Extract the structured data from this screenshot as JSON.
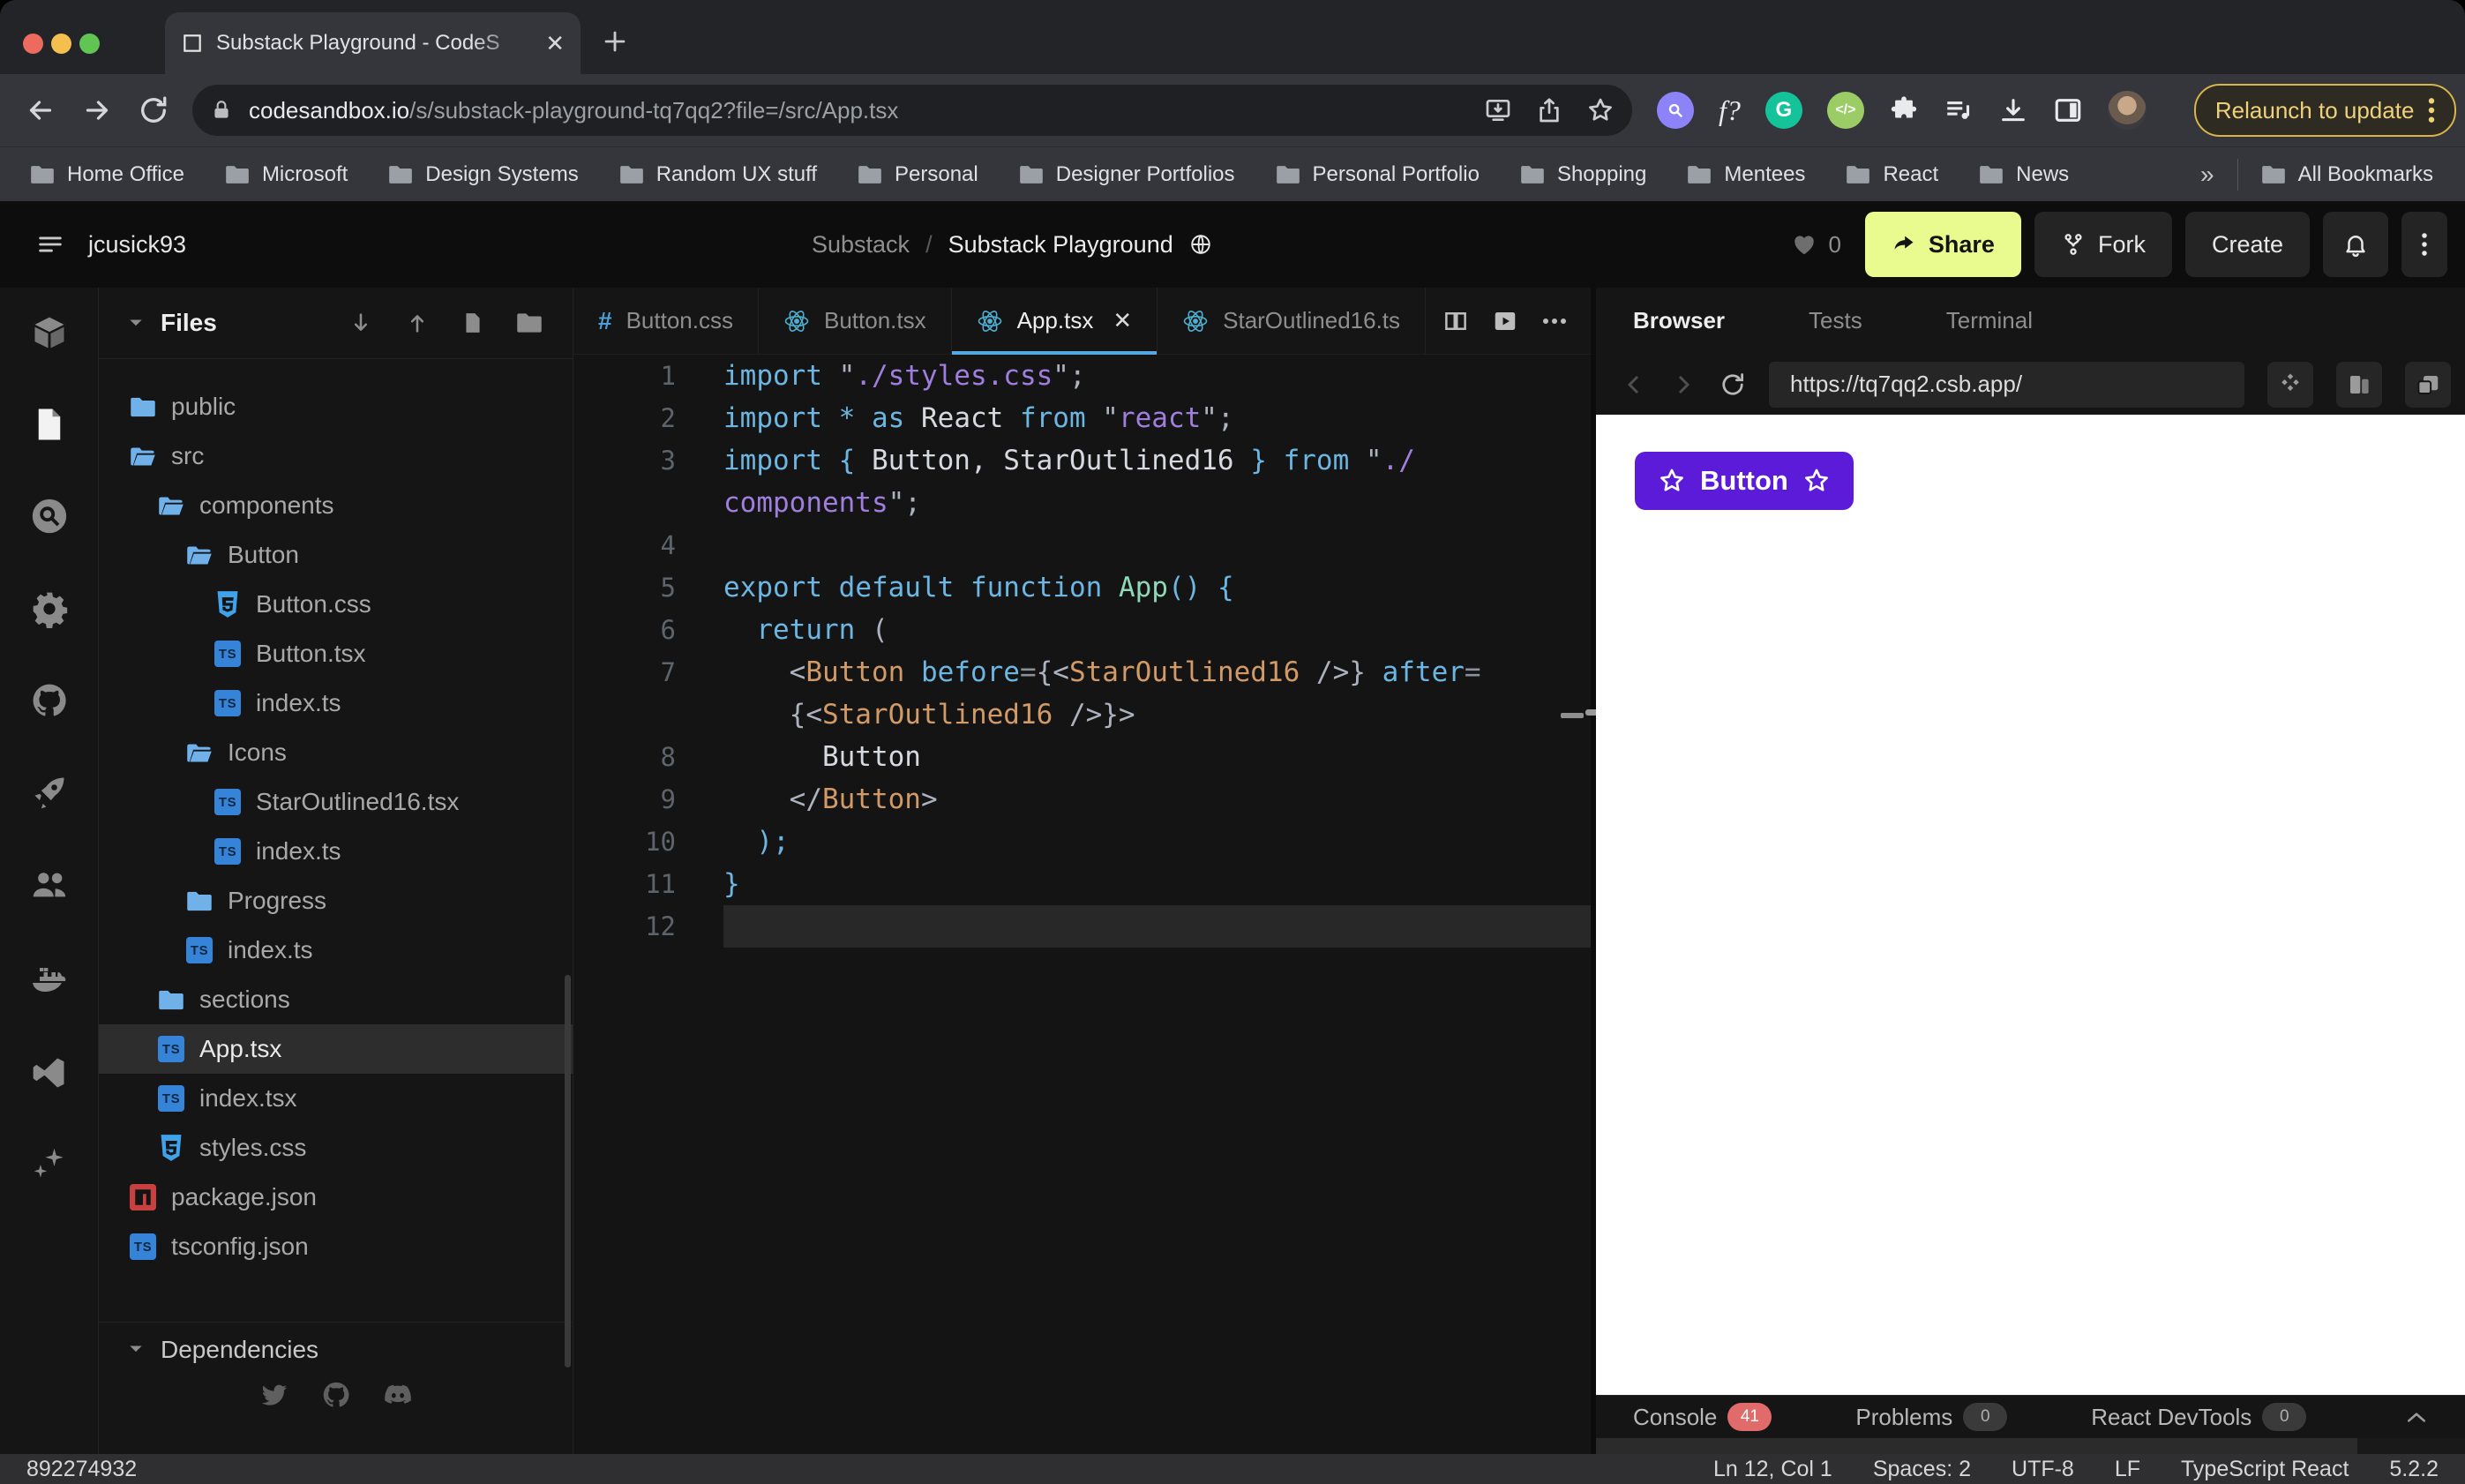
{
  "browser": {
    "tab_title": "Substack Playground - CodeS",
    "url_host": "codesandbox.io",
    "url_path": "/s/substack-playground-tq7qq2?file=/src/App.tsx",
    "relaunch_label": "Relaunch to update",
    "bookmarks": [
      "Home Office",
      "Microsoft",
      "Design Systems",
      "Random UX stuff",
      "Personal",
      "Designer Portfolios",
      "Personal Portfolio",
      "Shopping",
      "Mentees",
      "React",
      "News"
    ],
    "overflow_chevron": "»",
    "all_bookmarks_label": "All Bookmarks",
    "extension_letters": {
      "grammarly": "G",
      "font_finder": "f?"
    }
  },
  "header": {
    "username": "jcusick93",
    "breadcrumb_parent": "Substack",
    "breadcrumb_separator": "/",
    "breadcrumb_current": "Substack Playground",
    "likes_count": "0",
    "share_label": "Share",
    "fork_label": "Fork",
    "create_label": "Create",
    "share_color": "#E9FB8E"
  },
  "sidebar": {
    "title": "Files",
    "tree": [
      {
        "label": "public",
        "icon": "folder-closed",
        "level": 0
      },
      {
        "label": "src",
        "icon": "folder-open",
        "level": 0
      },
      {
        "label": "components",
        "icon": "folder-open",
        "level": 1
      },
      {
        "label": "Button",
        "icon": "folder-open",
        "level": 2
      },
      {
        "label": "Button.css",
        "icon": "css",
        "level": 3
      },
      {
        "label": "Button.tsx",
        "icon": "ts",
        "level": 3
      },
      {
        "label": "index.ts",
        "icon": "ts",
        "level": 3
      },
      {
        "label": "Icons",
        "icon": "folder-open",
        "level": 2
      },
      {
        "label": "StarOutlined16.tsx",
        "icon": "ts",
        "level": 3
      },
      {
        "label": "index.ts",
        "icon": "ts",
        "level": 3
      },
      {
        "label": "Progress",
        "icon": "folder-closed",
        "level": 2
      },
      {
        "label": "index.ts",
        "icon": "ts",
        "level": 2
      },
      {
        "label": "sections",
        "icon": "folder-closed",
        "level": 1
      },
      {
        "label": "App.tsx",
        "icon": "ts",
        "level": 1,
        "selected": true
      },
      {
        "label": "index.tsx",
        "icon": "ts",
        "level": 1
      },
      {
        "label": "styles.css",
        "icon": "css",
        "level": 1
      },
      {
        "label": "package.json",
        "icon": "npm",
        "level": 0
      },
      {
        "label": "tsconfig.json",
        "icon": "ts",
        "level": 0
      }
    ],
    "dependencies_label": "Dependencies"
  },
  "editor": {
    "tabs": [
      {
        "label": "Button.css",
        "icon": "hash",
        "active": false
      },
      {
        "label": "Button.tsx",
        "icon": "react",
        "active": false
      },
      {
        "label": "App.tsx",
        "icon": "react",
        "active": true,
        "closable": true
      },
      {
        "label": "StarOutlined16.ts",
        "icon": "react",
        "active": false
      }
    ],
    "close_glyph": "✕",
    "code_rows": [
      {
        "n": "1",
        "seg": [
          [
            "kw",
            "import"
          ],
          [
            "pun",
            " \""
          ],
          [
            "str",
            "./styles.css"
          ],
          [
            "pun",
            "\";"
          ]
        ]
      },
      {
        "n": "2",
        "seg": [
          [
            "kw",
            "import"
          ],
          [
            "pun",
            " "
          ],
          [
            "kw",
            "*"
          ],
          [
            "pun",
            " "
          ],
          [
            "kw",
            "as"
          ],
          [
            "txt",
            " React "
          ],
          [
            "kw",
            "from"
          ],
          [
            "pun",
            " \""
          ],
          [
            "str",
            "react"
          ],
          [
            "pun",
            "\";"
          ]
        ]
      },
      {
        "n": "3",
        "seg": [
          [
            "kw",
            "import"
          ],
          [
            "pun",
            " "
          ],
          [
            "kw",
            "{"
          ],
          [
            "txt",
            " Button, StarOutlined16 "
          ],
          [
            "kw",
            "}"
          ],
          [
            "pun",
            " "
          ],
          [
            "kw",
            "from"
          ],
          [
            "pun",
            " \""
          ],
          [
            "str",
            "./"
          ]
        ]
      },
      {
        "n": "",
        "seg": [
          [
            "str",
            "components"
          ],
          [
            "pun",
            "\";"
          ]
        ]
      },
      {
        "n": "4",
        "seg": []
      },
      {
        "n": "5",
        "seg": [
          [
            "kw",
            "export"
          ],
          [
            "pun",
            " "
          ],
          [
            "kw",
            "default"
          ],
          [
            "pun",
            " "
          ],
          [
            "kw",
            "function"
          ],
          [
            "pun",
            " "
          ],
          [
            "fn",
            "App"
          ],
          [
            "kw",
            "()"
          ],
          [
            "pun",
            " "
          ],
          [
            "kw",
            "{"
          ]
        ]
      },
      {
        "n": "6",
        "seg": [
          [
            "pun",
            "  "
          ],
          [
            "kw",
            "return"
          ],
          [
            "pun",
            " ("
          ]
        ]
      },
      {
        "n": "7",
        "seg": [
          [
            "pun",
            "    <"
          ],
          [
            "tag",
            "Button"
          ],
          [
            "pun",
            " "
          ],
          [
            "attr",
            "before"
          ],
          [
            "op",
            "="
          ],
          [
            "pun",
            "{<"
          ],
          [
            "tag",
            "StarOutlined16"
          ],
          [
            "pun",
            " />} "
          ],
          [
            "attr",
            "after"
          ],
          [
            "op",
            "="
          ]
        ]
      },
      {
        "n": "",
        "seg": [
          [
            "pun",
            "    {<"
          ],
          [
            "tag",
            "StarOutlined16"
          ],
          [
            "pun",
            " />}>"
          ]
        ]
      },
      {
        "n": "8",
        "seg": [
          [
            "txt",
            "      Button"
          ]
        ]
      },
      {
        "n": "9",
        "seg": [
          [
            "pun",
            "    </"
          ],
          [
            "tag",
            "Button"
          ],
          [
            "pun",
            ">"
          ]
        ]
      },
      {
        "n": "10",
        "seg": [
          [
            "pun",
            "  "
          ],
          [
            "kw",
            ");"
          ]
        ]
      },
      {
        "n": "11",
        "seg": [
          [
            "kw",
            "}"
          ]
        ]
      },
      {
        "n": "12",
        "seg": [],
        "current": true
      }
    ]
  },
  "preview": {
    "tabs": [
      {
        "label": "Browser",
        "active": true
      },
      {
        "label": "Tests",
        "active": false
      },
      {
        "label": "Terminal",
        "active": false
      }
    ],
    "url": "https://tq7qq2.csb.app/",
    "demo_button_label": "Button",
    "demo_button_color": "#5B1BD8",
    "console_tabs": [
      {
        "label": "Console",
        "badge": "41",
        "badge_color": "#E16A6A"
      },
      {
        "label": "Problems",
        "badge": "0",
        "badge_color": ""
      },
      {
        "label": "React DevTools",
        "badge": "0",
        "badge_color": ""
      }
    ]
  },
  "statusbar": {
    "sandbox_id": "892274932",
    "items": [
      "Ln 12, Col 1",
      "Spaces: 2",
      "UTF-8",
      "LF",
      "TypeScript React",
      "5.2.2"
    ]
  }
}
